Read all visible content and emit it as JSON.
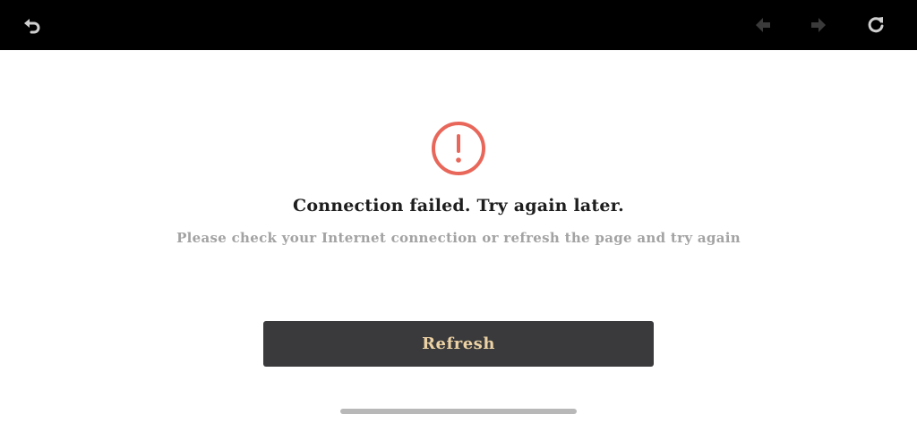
{
  "toolbar": {
    "back_icon": "undo-arrow-icon",
    "prev_icon": "arrow-left-icon",
    "next_icon": "arrow-right-icon",
    "reload_icon": "reload-icon"
  },
  "error": {
    "icon": "alert-circle-icon",
    "icon_color": "#e8675a",
    "title": "Connection failed. Try again later.",
    "message": "Please check your Internet connection or refresh the page and try again"
  },
  "actions": {
    "refresh_label": "Refresh",
    "button_color": "#3a3a3c",
    "label_color": "#ecd2a4"
  }
}
